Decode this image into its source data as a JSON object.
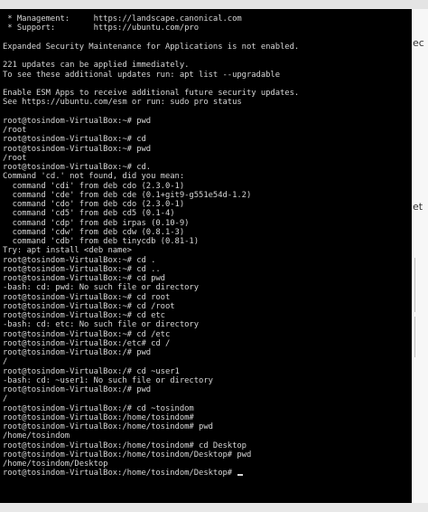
{
  "terminal": {
    "lines": [
      " * Management:     https://landscape.canonical.com",
      " * Support:        https://ubuntu.com/pro",
      "",
      "Expanded Security Maintenance for Applications is not enabled.",
      "",
      "221 updates can be applied immediately.",
      "To see these additional updates run: apt list --upgradable",
      "",
      "Enable ESM Apps to receive additional future security updates.",
      "See https://ubuntu.com/esm or run: sudo pro status",
      "",
      "root@tosindom-VirtualBox:~# pwd",
      "/root",
      "root@tosindom-VirtualBox:~# cd",
      "root@tosindom-VirtualBox:~# pwd",
      "/root",
      "root@tosindom-VirtualBox:~# cd.",
      "Command 'cd.' not found, did you mean:",
      "  command 'cdi' from deb cdo (2.3.0-1)",
      "  command 'cde' from deb cde (0.1+git9-g551e54d-1.2)",
      "  command 'cdo' from deb cdo (2.3.0-1)",
      "  command 'cd5' from deb cd5 (0.1-4)",
      "  command 'cdp' from deb irpas (0.10-9)",
      "  command 'cdw' from deb cdw (0.8.1-3)",
      "  command 'cdb' from deb tinycdb (0.81-1)",
      "Try: apt install <deb name>",
      "root@tosindom-VirtualBox:~# cd .",
      "root@tosindom-VirtualBox:~# cd ..",
      "root@tosindom-VirtualBox:~# cd pwd",
      "-bash: cd: pwd: No such file or directory",
      "root@tosindom-VirtualBox:~# cd root",
      "root@tosindom-VirtualBox:~# cd /root",
      "root@tosindom-VirtualBox:~# cd etc",
      "-bash: cd: etc: No such file or directory",
      "root@tosindom-VirtualBox:~# cd /etc",
      "root@tosindom-VirtualBox:/etc# cd /",
      "root@tosindom-VirtualBox:/# pwd",
      "/",
      "root@tosindom-VirtualBox:/# cd ~user1",
      "-bash: cd: ~user1: No such file or directory",
      "root@tosindom-VirtualBox:/# pwd",
      "/",
      "root@tosindom-VirtualBox:/# cd ~tosindom",
      "root@tosindom-VirtualBox:/home/tosindom#",
      "root@tosindom-VirtualBox:/home/tosindom# pwd",
      "/home/tosindom",
      "root@tosindom-VirtualBox:/home/tosindom# cd Desktop",
      "root@tosindom-VirtualBox:/home/tosindom/Desktop# pwd",
      "/home/tosindom/Desktop",
      "root@tosindom-VirtualBox:/home/tosindom/Desktop# "
    ]
  },
  "background": {
    "fragment_1": "ec",
    "fragment_2": "et"
  },
  "colors": {
    "terminal_bg": "#000000",
    "terminal_fg": "#d6d6d6",
    "page_bg": "#f2f2f2"
  }
}
